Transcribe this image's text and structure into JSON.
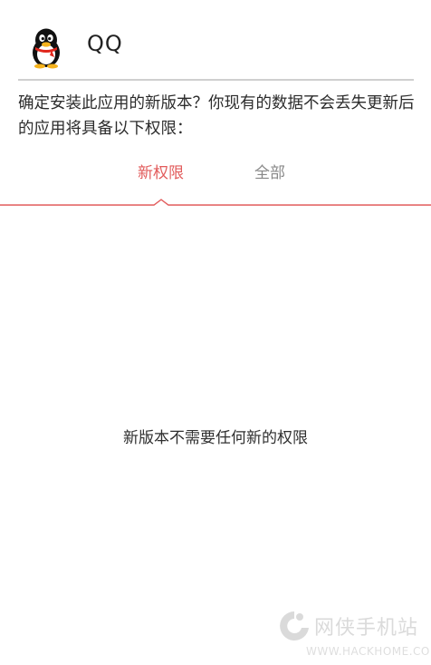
{
  "header": {
    "app_name": "QQ",
    "app_icon": "qq-penguin-icon"
  },
  "message": {
    "text": "确定安装此应用的新版本？你现有的数据不会丢失更新后的应用将具备以下权限："
  },
  "tabs": [
    {
      "label": "新权限",
      "active": true
    },
    {
      "label": "全部",
      "active": false
    }
  ],
  "content": {
    "empty_text": "新版本不需要任何新的权限"
  },
  "watermark": {
    "cn": "网侠手机站",
    "en": "WWW.HACKHOME.COM",
    "logo_icon": "hackhome-logo-icon"
  },
  "colors": {
    "accent": "#e25b5b",
    "inactive_tab": "#888888",
    "divider": "#cfcfcf"
  }
}
